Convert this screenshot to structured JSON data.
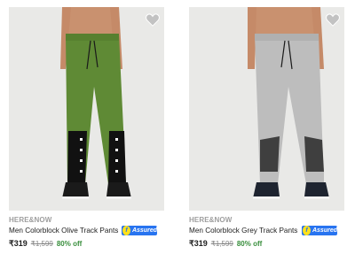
{
  "products": [
    {
      "brand": "HERE&NOW",
      "title": "Men Colorblock Olive Track Pants",
      "price": "₹319",
      "mrp": "₹1,599",
      "discount": "80% off",
      "assured_label": "Assured",
      "pant_color": "#5f8a35",
      "accent_color": "#111111",
      "wishlist_icon": "heart-icon"
    },
    {
      "brand": "HERE&NOW",
      "title": "Men Colorblock Grey Track Pants",
      "price": "₹319",
      "mrp": "₹1,599",
      "discount": "80% off",
      "assured_label": "Assured",
      "pant_color": "#bdbdbd",
      "accent_color": "#444444",
      "wishlist_icon": "heart-icon"
    }
  ],
  "colors": {
    "assured_blue": "#2874f0",
    "discount_green": "#388e3c",
    "strike_grey": "#878787"
  }
}
